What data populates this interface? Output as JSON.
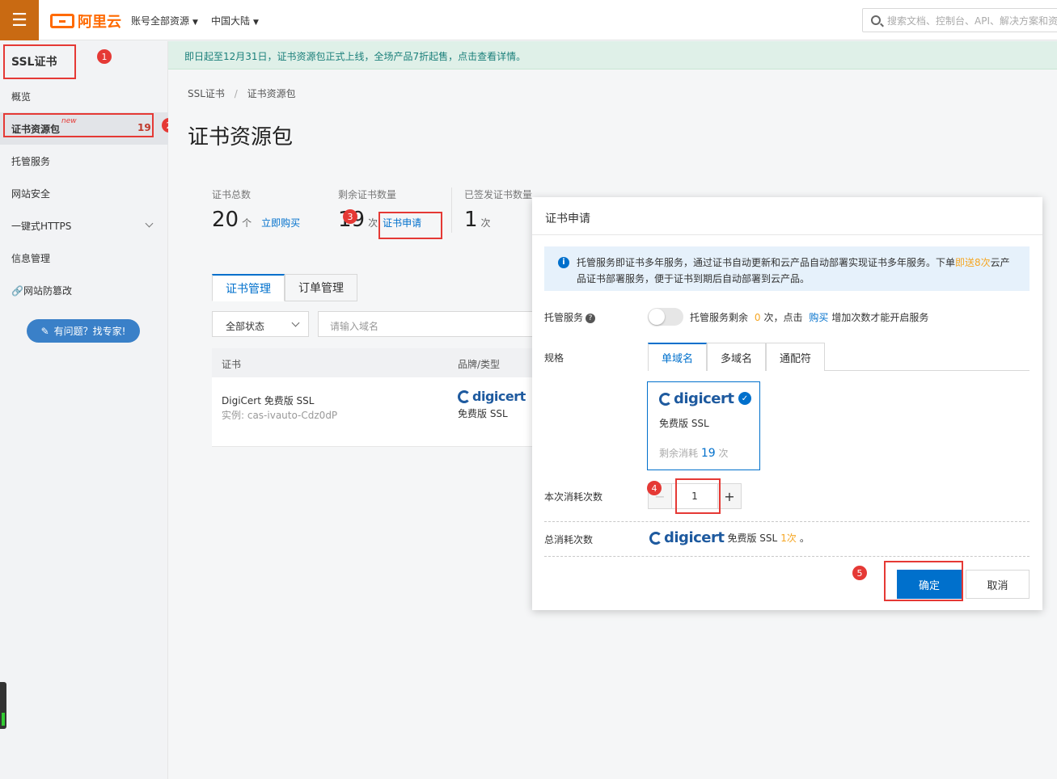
{
  "topbar": {
    "menu_icon": "hamburger-icon",
    "logo_text": "阿里云",
    "nav_account": "账号全部资源",
    "nav_region": "中国大陆",
    "search_placeholder": "搜索文档、控制台、API、解决方案和资源"
  },
  "sidebar": {
    "title": "SSL证书",
    "items": [
      {
        "label": "概览"
      },
      {
        "label": "证书资源包",
        "tag": "new",
        "count": "19"
      },
      {
        "label": "托管服务"
      },
      {
        "label": "网站安全"
      },
      {
        "label": "一键式HTTPS"
      },
      {
        "label": "信息管理"
      },
      {
        "label": "网站防篡改"
      }
    ],
    "expert_button": "有问题？找专家!"
  },
  "notice": "即日起至12月31日，证书资源包正式上线，全场产品7折起售，点击查看详情。",
  "breadcrumb": {
    "root": "SSL证书",
    "sep": "/",
    "current": "证书资源包"
  },
  "page_title": "证书资源包",
  "stats": {
    "total": {
      "label": "证书总数",
      "value": "20",
      "unit": "个",
      "link": "立即购买"
    },
    "remaining": {
      "label": "剩余证书数量",
      "value": "19",
      "unit": "次",
      "link": "证书申请"
    },
    "issued": {
      "label": "已签发证书数量",
      "value": "1",
      "unit": "次"
    }
  },
  "tabs": [
    "证书管理",
    "订单管理"
  ],
  "filter": {
    "status": "全部状态",
    "domain_placeholder": "请输入域名"
  },
  "table": {
    "headers": [
      "证书",
      "品牌/类型"
    ],
    "rows": [
      {
        "name": "DigiCert 免费版 SSL",
        "instance": "实例: cas-ivauto-Cdz0dP",
        "brand": "digicert",
        "type": "免费版 SSL"
      }
    ]
  },
  "modal": {
    "title": "证书申请",
    "info_before": "托管服务即证书多年服务，通过证书自动更新和云产品自动部署实现证书多年服务。下单",
    "info_highlight": "即送8次",
    "info_after": "云产品证书部署服务，便于证书到期后自动部署到云产品。",
    "hosting_label": "托管服务",
    "hosting_text_1": "托管服务剩余",
    "hosting_remaining": "0",
    "hosting_text_2": "次，点击",
    "hosting_buy": "购买",
    "hosting_text_3": "增加次数才能开启服务",
    "spec_label": "规格",
    "spec_tabs": [
      "单域名",
      "多域名",
      "通配符"
    ],
    "card_brand": "digicert",
    "card_type": "免费版 SSL",
    "card_remaining_label": "剩余消耗",
    "card_remaining_value": "19",
    "card_remaining_unit": "次",
    "consume_label": "本次消耗次数",
    "consume_value": "1",
    "total_label": "总消耗次数",
    "total_type": "免费版 SSL",
    "total_count": "1次",
    "total_end": "。",
    "confirm": "确定",
    "cancel": "取消"
  },
  "annotations": [
    "1",
    "2",
    "3",
    "4",
    "5"
  ],
  "colors": {
    "accent": "#0070cc",
    "brand_orange": "#ff6a00",
    "highlight_red": "#e53935"
  }
}
